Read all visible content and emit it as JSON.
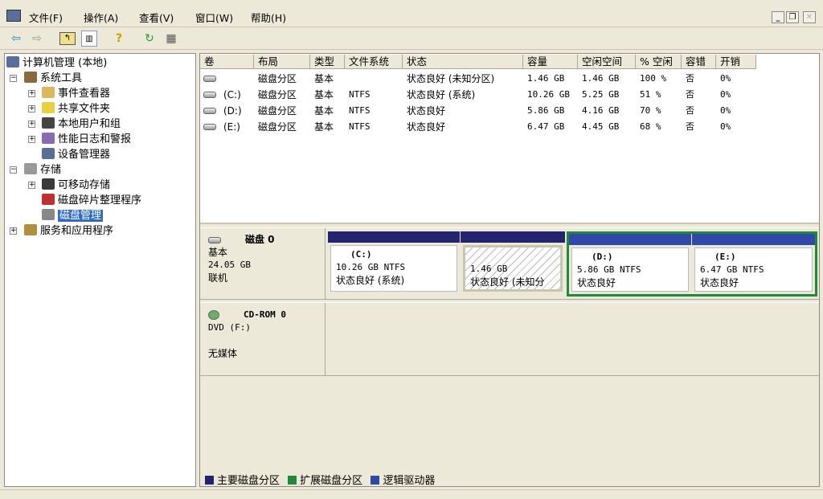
{
  "colors": {
    "primary": "#23236e",
    "extended": "#1f8a3a",
    "logical": "#3048a8",
    "selection": "#316ac5"
  },
  "menu": [
    "文件(F)",
    "操作(A)",
    "查看(V)",
    "窗口(W)",
    "帮助(H)"
  ],
  "window_buttons": {
    "minimize": "_",
    "restore": "❐",
    "close": "✕"
  },
  "toolbar": [
    "back-icon",
    "forward-icon",
    "up-folder-icon",
    "show-hide-tree-icon",
    "help-icon",
    "refresh-icon",
    "properties-icon"
  ],
  "tree": {
    "root": "计算机管理 (本地)",
    "system_tools": "系统工具",
    "event_viewer": "事件查看器",
    "shared_folders": "共享文件夹",
    "local_users": "本地用户和组",
    "perf_logs": "性能日志和警报",
    "device_manager": "设备管理器",
    "storage": "存储",
    "removable": "可移动存储",
    "defrag": "磁盘碎片整理程序",
    "disk_mgmt": "磁盘管理",
    "services": "服务和应用程序"
  },
  "table": {
    "headers": [
      "卷",
      "布局",
      "类型",
      "文件系统",
      "状态",
      "容量",
      "空闲空间",
      "% 空闲",
      "容错",
      "开销"
    ],
    "rows": [
      [
        "",
        "磁盘分区",
        "基本",
        "",
        "状态良好 (未知分区)",
        "1.46 GB",
        "1.46 GB",
        "100 %",
        "否",
        "0%"
      ],
      [
        "(C:)",
        "磁盘分区",
        "基本",
        "NTFS",
        "状态良好 (系统)",
        "10.26 GB",
        "5.25 GB",
        "51 %",
        "否",
        "0%"
      ],
      [
        "(D:)",
        "磁盘分区",
        "基本",
        "NTFS",
        "状态良好",
        "5.86 GB",
        "4.16 GB",
        "70 %",
        "否",
        "0%"
      ],
      [
        "(E:)",
        "磁盘分区",
        "基本",
        "NTFS",
        "状态良好",
        "6.47 GB",
        "4.45 GB",
        "68 %",
        "否",
        "0%"
      ]
    ]
  },
  "disk0": {
    "name": "磁盘 0",
    "type": "基本",
    "size": "24.05 GB",
    "status": "联机",
    "partitions": [
      {
        "label": "(C:)",
        "size": "10.26 GB NTFS",
        "status": "状态良好 (系统)"
      },
      {
        "label": "",
        "size": "1.46 GB",
        "status": "状态良好 (未知分"
      },
      {
        "label": "(D:)",
        "size": "5.86 GB NTFS",
        "status": "状态良好"
      },
      {
        "label": "(E:)",
        "size": "6.47 GB NTFS",
        "status": "状态良好"
      }
    ]
  },
  "cdrom": {
    "name": "CD-ROM 0",
    "type": "DVD (F:)",
    "status": "无媒体"
  },
  "legend": [
    "主要磁盘分区",
    "扩展磁盘分区",
    "逻辑驱动器"
  ]
}
